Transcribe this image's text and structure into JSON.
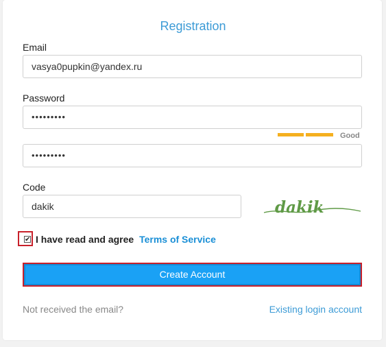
{
  "form": {
    "title": "Registration",
    "email": {
      "label": "Email",
      "value": "vasya0pupkin@yandex.ru"
    },
    "password": {
      "label": "Password",
      "masked": "•••••••••"
    },
    "password_strength": {
      "label": "Good",
      "level": 0.66
    },
    "confirm_password": {
      "masked": "•••••••••"
    },
    "code": {
      "label": "Code",
      "value": "dakik"
    },
    "captcha": {
      "text": "dakik"
    },
    "agree": {
      "text": "I have read and agree",
      "link": "Terms of Service",
      "checked": true
    },
    "submit_label": "Create Account",
    "footer": {
      "not_received": "Not received the email?",
      "existing_login": "Existing login account"
    }
  }
}
